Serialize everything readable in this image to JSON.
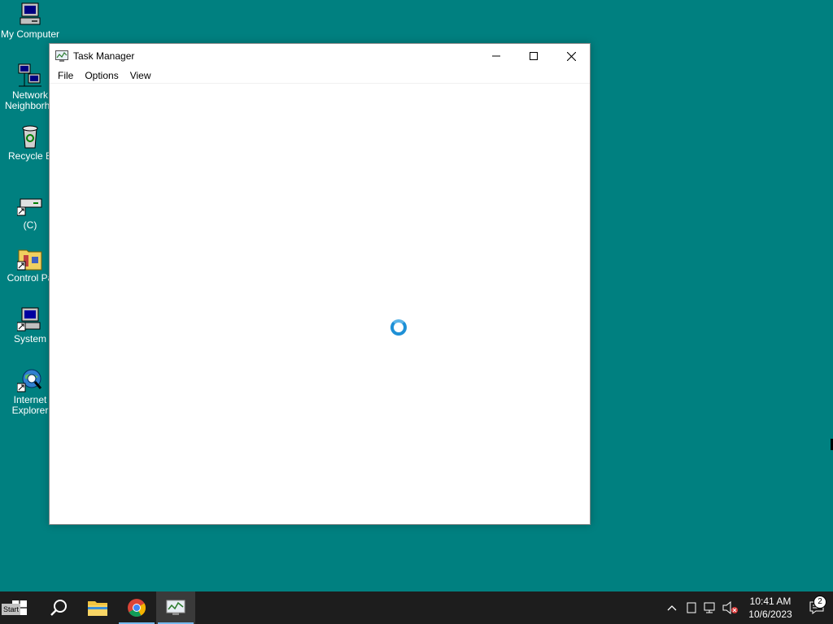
{
  "desktop": {
    "icons": [
      {
        "label": "My Computer",
        "icon": "my-computer-icon"
      },
      {
        "label": "Network\nNeighborho",
        "icon": "network-neighborhood-icon"
      },
      {
        "label": "Recycle B",
        "icon": "recycle-bin-icon"
      },
      {
        "label": "(C)",
        "icon": "drive-c-icon"
      },
      {
        "label": "Control Pa",
        "icon": "control-panel-icon"
      },
      {
        "label": "System",
        "icon": "system-icon"
      },
      {
        "label": "Internet\nExplorer",
        "icon": "internet-explorer-icon"
      }
    ]
  },
  "window": {
    "title": "Task Manager",
    "menu": [
      "File",
      "Options",
      "View"
    ],
    "state": "loading"
  },
  "taskbar": {
    "start_label": "Start",
    "apps": [
      {
        "name": "search",
        "icon": "search-icon"
      },
      {
        "name": "file-explorer",
        "icon": "folder-icon"
      },
      {
        "name": "chrome",
        "icon": "chrome-icon"
      },
      {
        "name": "task-manager",
        "icon": "task-manager-icon"
      }
    ],
    "clock": {
      "time": "10:41 AM",
      "date": "10/6/2023"
    },
    "notification_count": "2"
  },
  "colors": {
    "desktop": "#008080",
    "taskbar": "#1d1d1d",
    "accent": "#1e90d6"
  }
}
